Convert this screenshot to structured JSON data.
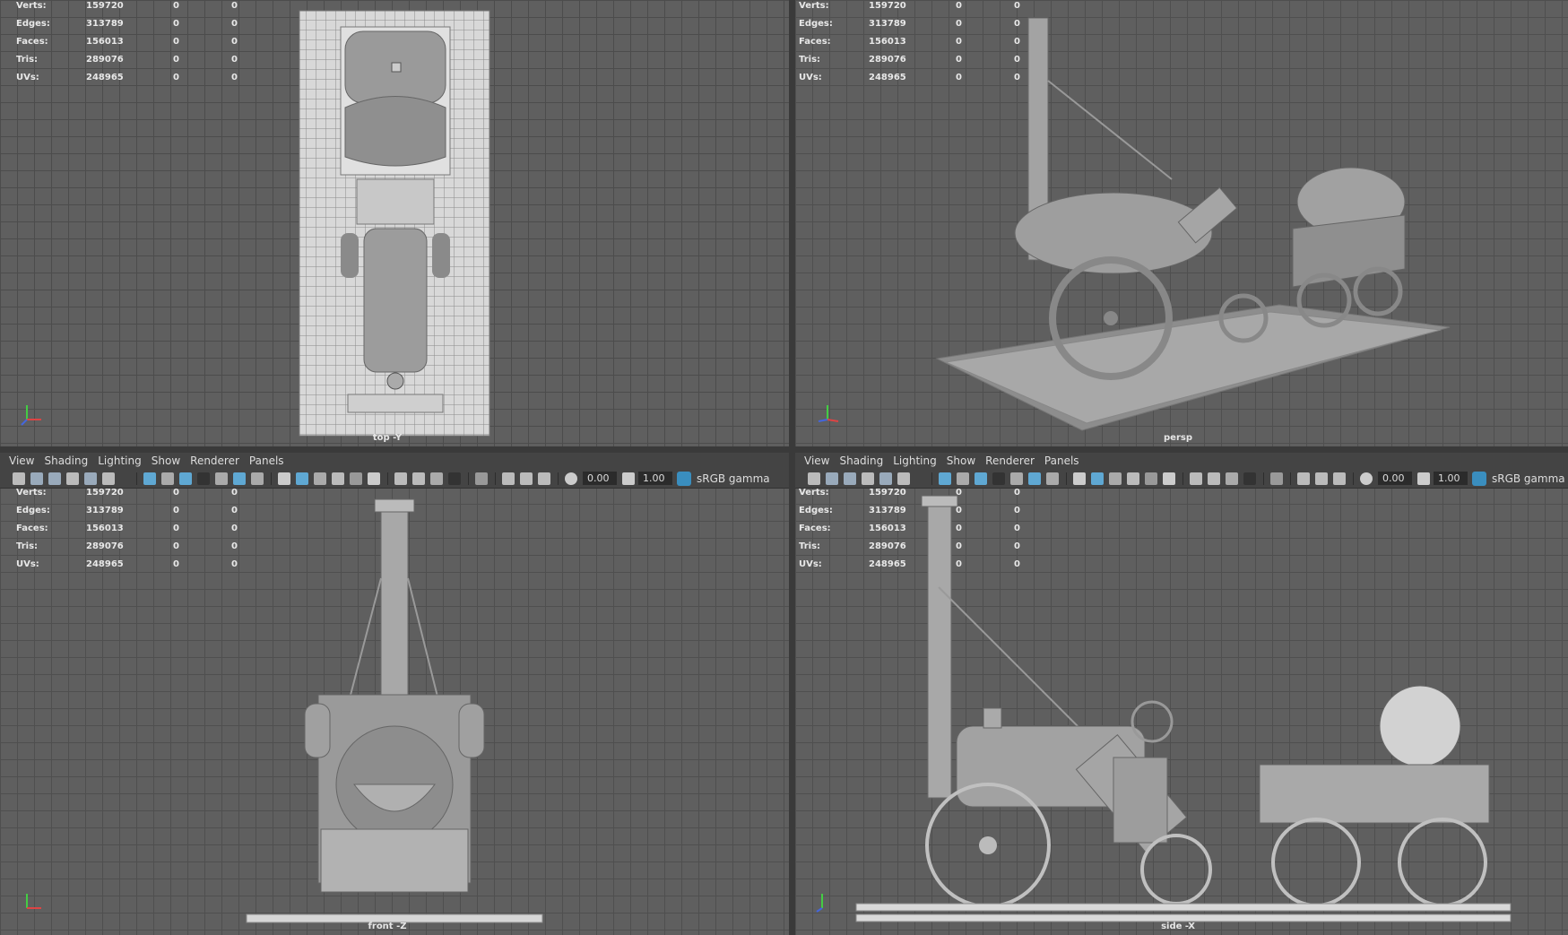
{
  "menus": [
    "View",
    "Shading",
    "Lighting",
    "Show",
    "Renderer",
    "Panels"
  ],
  "toolbar": {
    "exposure": "0.00",
    "gamma": "1.00",
    "colorspace": "sRGB gamma"
  },
  "hud": {
    "rows": [
      {
        "label": "Verts:",
        "v1": "159720",
        "v2": "0",
        "v3": "0"
      },
      {
        "label": "Edges:",
        "v1": "313789",
        "v2": "0",
        "v3": "0"
      },
      {
        "label": "Faces:",
        "v1": "156013",
        "v2": "0",
        "v3": "0"
      },
      {
        "label": "Tris:",
        "v1": "289076",
        "v2": "0",
        "v3": "0"
      },
      {
        "label": "UVs:",
        "v1": "248965",
        "v2": "0",
        "v3": "0"
      }
    ]
  },
  "viewports": {
    "top": {
      "camera": "top -Y"
    },
    "persp": {
      "camera": "persp"
    },
    "front": {
      "camera": "front -Z"
    },
    "side": {
      "camera": "side -X"
    }
  },
  "colors": {
    "viewport_bg": "#5f5f5f",
    "grid": "#4f4f4f",
    "model": "#b5b5b5",
    "panel": "#444444",
    "accent": "#3a8ebf"
  }
}
